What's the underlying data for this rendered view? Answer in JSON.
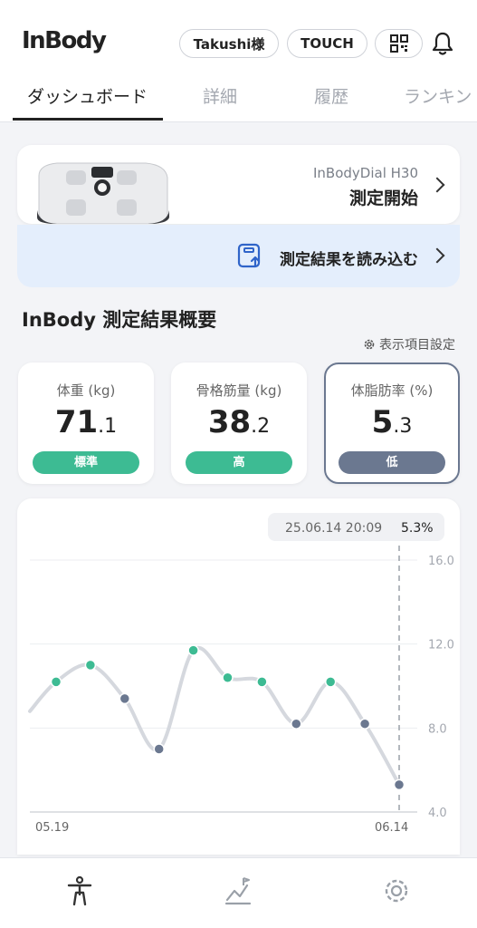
{
  "header": {
    "logo": "InBody",
    "user_label": "Takushi様",
    "touch_label": "TOUCH",
    "qr_icon": "qr-code-icon",
    "bell_icon": "bell-icon"
  },
  "tabs": [
    {
      "label": "ダッシュボード",
      "active": true
    },
    {
      "label": "詳細",
      "active": false
    },
    {
      "label": "履歴",
      "active": false
    },
    {
      "label": "ランキン",
      "active": false
    }
  ],
  "device": {
    "name": "InBodyDial H30",
    "action": "測定開始",
    "icon": "scale-device-image"
  },
  "import": {
    "label": "測定結果を読み込む",
    "icon": "import-upload-icon"
  },
  "summary": {
    "title": "InBody 測定結果概要",
    "settings_label": "表示項目設定",
    "settings_icon": "gear-icon"
  },
  "metrics": [
    {
      "label": "体重 (kg)",
      "int": "71",
      "dec": ".1",
      "badge": "標準",
      "badge_color": "#3dbb93",
      "selected": false
    },
    {
      "label": "骨格筋量 (kg)",
      "int": "38",
      "dec": ".2",
      "badge": "高",
      "badge_color": "#3dbb93",
      "selected": false
    },
    {
      "label": "体脂肪率 (%)",
      "int": "5",
      "dec": ".3",
      "badge": "低",
      "badge_color": "#6b7890",
      "selected": true
    }
  ],
  "chart_data": {
    "type": "line",
    "tooltip_date": "25.06.14 20:09",
    "tooltip_value": "5.3%",
    "x_start_label": "05.19",
    "x_end_label": "06.14",
    "y_ticks": [
      "16.0",
      "12.0",
      "8.0",
      "4.0"
    ],
    "ylim": [
      4,
      16
    ],
    "values": [
      10.2,
      11.0,
      9.4,
      7.0,
      11.7,
      10.4,
      10.2,
      8.2,
      10.2,
      8.2,
      5.3
    ],
    "point_status": [
      "normal",
      "normal",
      "low",
      "low",
      "normal",
      "normal",
      "normal",
      "low",
      "normal",
      "low",
      "low"
    ],
    "colors": {
      "normal": "#3dbb93",
      "low": "#6b7890",
      "line": "#d5d8de"
    }
  },
  "bottom_nav": [
    {
      "icon": "person-icon",
      "active": true
    },
    {
      "icon": "chart-icon",
      "active": false
    },
    {
      "icon": "settings-gear-icon",
      "active": false
    }
  ]
}
